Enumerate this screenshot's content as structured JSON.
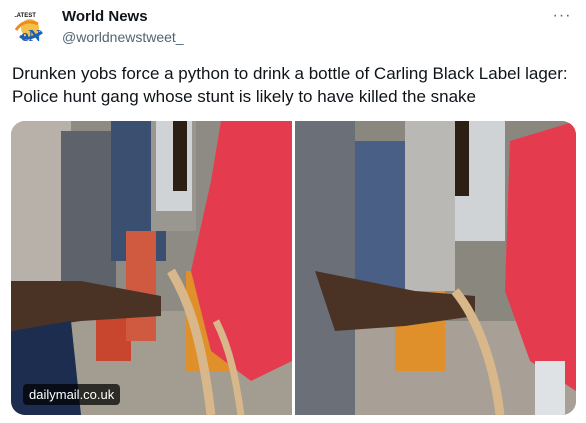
{
  "account": {
    "display_name": "World News",
    "handle": "@worldnewstweet_",
    "avatar_text": "LATEST",
    "avatar_icon": "world-news-logo-icon"
  },
  "actions": {
    "more_icon": "more-options-icon",
    "more_label": "···"
  },
  "tweet": {
    "text": "Drunken yobs force a python to drink a bottle of Carling Black Label lager: Police hunt gang whose stunt is likely to have killed the snake"
  },
  "media": {
    "source_badge": "dailymail.co.uk",
    "image_count": 2
  },
  "colors": {
    "text_primary": "#0f1419",
    "text_secondary": "#536471",
    "logo_orange": "#f08c1e",
    "logo_blue": "#1d5fb5",
    "shirt_red": "#e53b4e"
  }
}
